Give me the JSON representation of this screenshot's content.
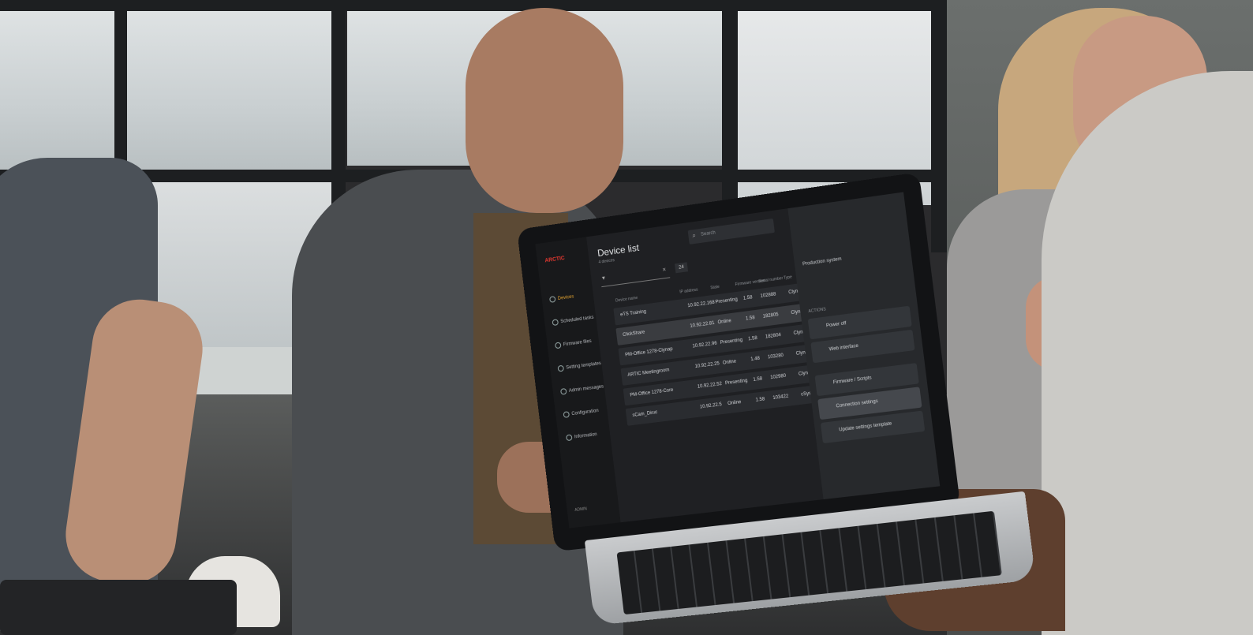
{
  "app": {
    "title": "Device list",
    "subtitle": "4 devices",
    "search_placeholder": "Search",
    "filter_count": "24",
    "logo_text": "ARCTIC"
  },
  "sidebar": {
    "items": [
      {
        "label": "Devices"
      },
      {
        "label": "Scheduled tasks"
      },
      {
        "label": "Firmware files"
      },
      {
        "label": "Setting templates"
      },
      {
        "label": "Admin messages"
      },
      {
        "label": "Configuration"
      },
      {
        "label": "Information"
      }
    ],
    "footer": "ADMIN"
  },
  "table": {
    "headers": [
      "Device name",
      "IP address",
      "State",
      "Firmware version",
      "Serial number",
      "Type"
    ],
    "rows": [
      {
        "name": "eTS Training",
        "ip": "10.92.22.168",
        "state": "Presenting",
        "fw": "1.58",
        "serial": "102888",
        "type": "Clynap Pro"
      },
      {
        "name": "ClickShare",
        "ip": "10.92.22.81",
        "state": "Online",
        "fw": "1.58",
        "serial": "182805",
        "type": "Clynap"
      },
      {
        "name": "PM-Office 1278-Clynap",
        "ip": "10.92.22.96",
        "state": "Presenting",
        "fw": "1.58",
        "serial": "182804",
        "type": "Clynap"
      },
      {
        "name": "ARTIC Meetingroom",
        "ip": "10.92.22.25",
        "state": "Online",
        "fw": "1.48",
        "serial": "103280",
        "type": "Clynap Core"
      },
      {
        "name": "PM-Office 1278-Core",
        "ip": "10.92.22.52",
        "state": "Presenting",
        "fw": "1.58",
        "serial": "102980",
        "type": "Clynap Core"
      },
      {
        "name": "sCam_Dinxl",
        "ip": "10.92.22.5",
        "state": "Online",
        "fw": "1.58",
        "serial": "103422",
        "type": "cSystem Core"
      }
    ]
  },
  "panel": {
    "section1": "Production system",
    "section2": "ACTIONS",
    "buttons": [
      {
        "label": "Power off"
      },
      {
        "label": "Web interface"
      },
      {
        "label": "Firmware / Scripts"
      },
      {
        "label": "Connection settings"
      },
      {
        "label": "Update settings template"
      }
    ]
  }
}
